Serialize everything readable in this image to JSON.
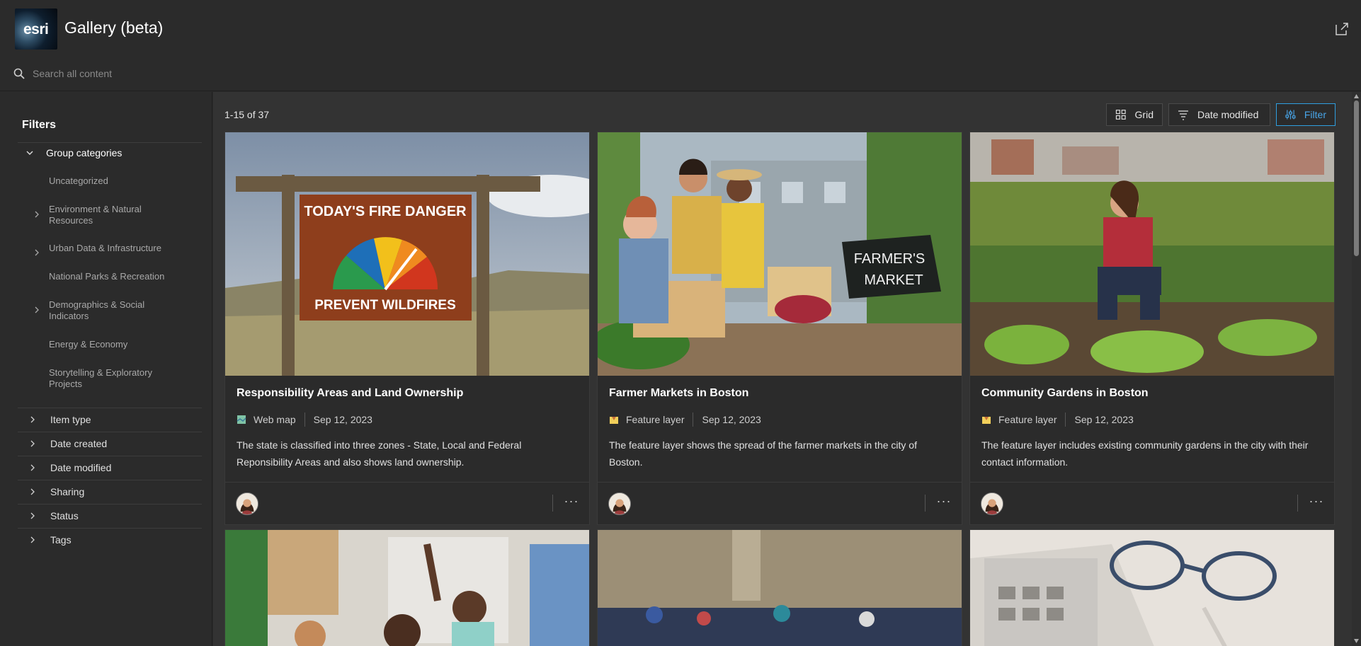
{
  "app": {
    "logo_text": "esri",
    "title": "Gallery (beta)"
  },
  "search": {
    "placeholder": "Search all content"
  },
  "sidebar": {
    "title": "Filters",
    "group_label": "Group categories",
    "categories": [
      {
        "label": "Uncategorized",
        "expandable": false
      },
      {
        "label": "Environment & Natural Resources",
        "expandable": true
      },
      {
        "label": "Urban Data & Infrastructure",
        "expandable": true
      },
      {
        "label": "National Parks & Recreation",
        "expandable": false
      },
      {
        "label": "Demographics & Social Indicators",
        "expandable": true
      },
      {
        "label": "Energy & Economy",
        "expandable": false
      },
      {
        "label": "Storytelling & Exploratory Projects",
        "expandable": false
      }
    ],
    "sections": [
      "Item type",
      "Date created",
      "Date modified",
      "Sharing",
      "Status",
      "Tags"
    ]
  },
  "toolbar": {
    "count": "1-15 of 37",
    "grid_label": "Grid",
    "sort_label": "Date modified",
    "filter_label": "Filter"
  },
  "colors": {
    "accent": "#2f9fe0",
    "background": "#2b2b2b",
    "panel": "#333333"
  },
  "cards": [
    {
      "title": "Responsibility Areas and Land Ownership",
      "type": "Web map",
      "type_icon": "web-map-icon",
      "date": "Sep 12, 2023",
      "description": "The state is classified into three zones - State, Local and Federal Reponsibility Areas and also shows land ownership.",
      "sign_title": "TODAY'S FIRE DANGER",
      "sign_footer": "PREVENT WILDFIRES"
    },
    {
      "title": "Farmer Markets in Boston",
      "type": "Feature layer",
      "type_icon": "feature-layer-icon",
      "date": "Sep 12, 2023",
      "description": "The feature layer shows the spread of the farmer markets in the city of Boston.",
      "sign_text_1": "FARMER'S",
      "sign_text_2": "MARKET"
    },
    {
      "title": "Community Gardens in Boston",
      "type": "Feature layer",
      "type_icon": "feature-layer-icon",
      "date": "Sep 12, 2023",
      "description": "The feature layer includes existing community gardens in the city with their contact information."
    }
  ],
  "more_label": "···"
}
